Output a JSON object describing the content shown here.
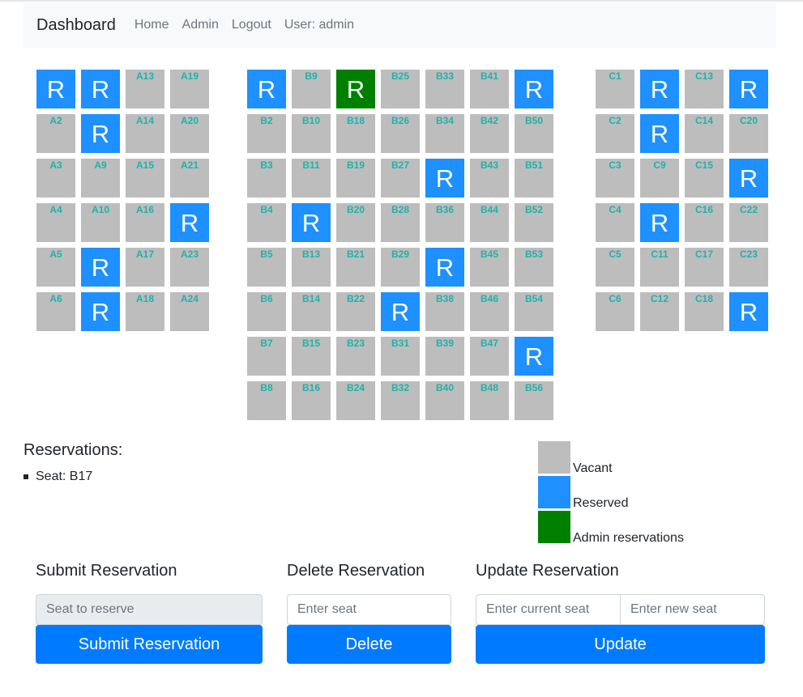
{
  "navbar": {
    "brand": "Dashboard",
    "links": [
      "Home",
      "Admin",
      "Logout"
    ],
    "user_text": "User: admin"
  },
  "seat_marker": "R",
  "colors": {
    "vacant": "#bdbdbd",
    "reserved": "#1e90ff",
    "admin": "#008000",
    "seat_label": "#20b2aa",
    "button": "#007bff"
  },
  "sections": [
    {
      "name": "A",
      "columns": [
        [
          {
            "id": "A1",
            "status": "reserved"
          },
          {
            "id": "A2",
            "status": "vacant"
          },
          {
            "id": "A3",
            "status": "vacant"
          },
          {
            "id": "A4",
            "status": "vacant"
          },
          {
            "id": "A5",
            "status": "vacant"
          },
          {
            "id": "A6",
            "status": "vacant"
          }
        ],
        [
          {
            "id": "A7",
            "status": "reserved"
          },
          {
            "id": "A8",
            "status": "reserved"
          },
          {
            "id": "A9",
            "status": "vacant"
          },
          {
            "id": "A10",
            "status": "vacant"
          },
          {
            "id": "A11",
            "status": "reserved"
          },
          {
            "id": "A12",
            "status": "reserved"
          }
        ],
        [
          {
            "id": "A13",
            "status": "vacant"
          },
          {
            "id": "A14",
            "status": "vacant"
          },
          {
            "id": "A15",
            "status": "vacant"
          },
          {
            "id": "A16",
            "status": "vacant"
          },
          {
            "id": "A17",
            "status": "vacant"
          },
          {
            "id": "A18",
            "status": "vacant"
          }
        ],
        [
          {
            "id": "A19",
            "status": "vacant"
          },
          {
            "id": "A20",
            "status": "vacant"
          },
          {
            "id": "A21",
            "status": "vacant"
          },
          {
            "id": "A22",
            "status": "reserved"
          },
          {
            "id": "A23",
            "status": "vacant"
          },
          {
            "id": "A24",
            "status": "vacant"
          }
        ]
      ]
    },
    {
      "name": "B",
      "columns": [
        [
          {
            "id": "B1",
            "status": "reserved"
          },
          {
            "id": "B2",
            "status": "vacant"
          },
          {
            "id": "B3",
            "status": "vacant"
          },
          {
            "id": "B4",
            "status": "vacant"
          },
          {
            "id": "B5",
            "status": "vacant"
          },
          {
            "id": "B6",
            "status": "vacant"
          },
          {
            "id": "B7",
            "status": "vacant"
          },
          {
            "id": "B8",
            "status": "vacant"
          }
        ],
        [
          {
            "id": "B9",
            "status": "vacant"
          },
          {
            "id": "B10",
            "status": "vacant"
          },
          {
            "id": "B11",
            "status": "vacant"
          },
          {
            "id": "B12",
            "status": "reserved"
          },
          {
            "id": "B13",
            "status": "vacant"
          },
          {
            "id": "B14",
            "status": "vacant"
          },
          {
            "id": "B15",
            "status": "vacant"
          },
          {
            "id": "B16",
            "status": "vacant"
          }
        ],
        [
          {
            "id": "B17",
            "status": "admin"
          },
          {
            "id": "B18",
            "status": "vacant"
          },
          {
            "id": "B19",
            "status": "vacant"
          },
          {
            "id": "B20",
            "status": "vacant"
          },
          {
            "id": "B21",
            "status": "vacant"
          },
          {
            "id": "B22",
            "status": "vacant"
          },
          {
            "id": "B23",
            "status": "vacant"
          },
          {
            "id": "B24",
            "status": "vacant"
          }
        ],
        [
          {
            "id": "B25",
            "status": "vacant"
          },
          {
            "id": "B26",
            "status": "vacant"
          },
          {
            "id": "B27",
            "status": "vacant"
          },
          {
            "id": "B28",
            "status": "vacant"
          },
          {
            "id": "B29",
            "status": "vacant"
          },
          {
            "id": "B30",
            "status": "reserved"
          },
          {
            "id": "B31",
            "status": "vacant"
          },
          {
            "id": "B32",
            "status": "vacant"
          }
        ],
        [
          {
            "id": "B33",
            "status": "vacant"
          },
          {
            "id": "B34",
            "status": "vacant"
          },
          {
            "id": "B35",
            "status": "reserved"
          },
          {
            "id": "B36",
            "status": "vacant"
          },
          {
            "id": "B37",
            "status": "reserved"
          },
          {
            "id": "B38",
            "status": "vacant"
          },
          {
            "id": "B39",
            "status": "vacant"
          },
          {
            "id": "B40",
            "status": "vacant"
          }
        ],
        [
          {
            "id": "B41",
            "status": "vacant"
          },
          {
            "id": "B42",
            "status": "vacant"
          },
          {
            "id": "B43",
            "status": "vacant"
          },
          {
            "id": "B44",
            "status": "vacant"
          },
          {
            "id": "B45",
            "status": "vacant"
          },
          {
            "id": "B46",
            "status": "vacant"
          },
          {
            "id": "B47",
            "status": "vacant"
          },
          {
            "id": "B48",
            "status": "vacant"
          }
        ],
        [
          {
            "id": "B49",
            "status": "reserved"
          },
          {
            "id": "B50",
            "status": "vacant"
          },
          {
            "id": "B51",
            "status": "vacant"
          },
          {
            "id": "B52",
            "status": "vacant"
          },
          {
            "id": "B53",
            "status": "vacant"
          },
          {
            "id": "B54",
            "status": "vacant"
          },
          {
            "id": "B55",
            "status": "reserved"
          },
          {
            "id": "B56",
            "status": "vacant"
          }
        ]
      ]
    },
    {
      "name": "C",
      "columns": [
        [
          {
            "id": "C1",
            "status": "vacant"
          },
          {
            "id": "C2",
            "status": "vacant"
          },
          {
            "id": "C3",
            "status": "vacant"
          },
          {
            "id": "C4",
            "status": "vacant"
          },
          {
            "id": "C5",
            "status": "vacant"
          },
          {
            "id": "C6",
            "status": "vacant"
          }
        ],
        [
          {
            "id": "C7",
            "status": "reserved"
          },
          {
            "id": "C8",
            "status": "reserved"
          },
          {
            "id": "C9",
            "status": "vacant"
          },
          {
            "id": "C10",
            "status": "reserved"
          },
          {
            "id": "C11",
            "status": "vacant"
          },
          {
            "id": "C12",
            "status": "vacant"
          }
        ],
        [
          {
            "id": "C13",
            "status": "vacant"
          },
          {
            "id": "C14",
            "status": "vacant"
          },
          {
            "id": "C15",
            "status": "vacant"
          },
          {
            "id": "C16",
            "status": "vacant"
          },
          {
            "id": "C17",
            "status": "vacant"
          },
          {
            "id": "C18",
            "status": "vacant"
          }
        ],
        [
          {
            "id": "C19",
            "status": "reserved"
          },
          {
            "id": "C20",
            "status": "vacant"
          },
          {
            "id": "C21",
            "status": "reserved"
          },
          {
            "id": "C22",
            "status": "vacant"
          },
          {
            "id": "C23",
            "status": "vacant"
          },
          {
            "id": "C24",
            "status": "reserved"
          }
        ]
      ]
    }
  ],
  "reservations": {
    "title": "Reservations:",
    "items": [
      "Seat: B17"
    ]
  },
  "legend": [
    {
      "label": "Vacant",
      "color": "#bdbdbd"
    },
    {
      "label": "Reserved",
      "color": "#1e90ff"
    },
    {
      "label": "Admin reservations",
      "color": "#008000"
    }
  ],
  "forms": {
    "submit": {
      "title": "Submit Reservation",
      "seat_placeholder": "Seat to reserve",
      "button": "Submit Reservation"
    },
    "delete": {
      "title": "Delete Reservation",
      "seat_placeholder": "Enter seat",
      "button": "Delete"
    },
    "update": {
      "title": "Update Reservation",
      "current_placeholder": "Enter current seat",
      "new_placeholder": "Enter new seat",
      "button": "Update"
    }
  }
}
